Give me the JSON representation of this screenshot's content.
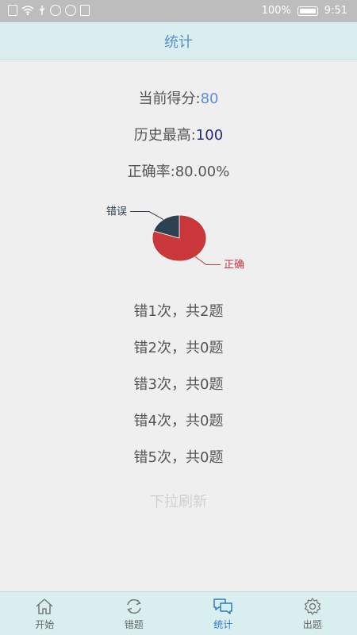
{
  "status_bar": {
    "battery": "100%",
    "time": "9:51"
  },
  "header": {
    "title": "统计"
  },
  "stats": {
    "current_score_label": "当前得分:",
    "current_score_value": "80",
    "best_label": "历史最高:",
    "best_value": "100",
    "accuracy_label": "正确率:",
    "accuracy_value": "80.00%"
  },
  "chart_data": {
    "type": "pie",
    "slices": [
      {
        "name": "正确",
        "value": 80,
        "color": "#c9373a"
      },
      {
        "name": "错误",
        "value": 20,
        "color": "#2e4152"
      }
    ],
    "labels": [
      "错误",
      "正确"
    ]
  },
  "wrong_counts": [
    "错1次，共2题",
    "错2次，共0题",
    "错3次，共0题",
    "错4次，共0题",
    "错5次，共0题"
  ],
  "refresh_hint": "下拉刷新",
  "nav": {
    "items": [
      {
        "label": "开始",
        "icon": "home-icon"
      },
      {
        "label": "错题",
        "icon": "refresh-icon"
      },
      {
        "label": "统计",
        "icon": "chat-icon"
      },
      {
        "label": "出题",
        "icon": "gear-icon"
      }
    ],
    "active_index": 2,
    "active_color": "#2e78c9"
  }
}
